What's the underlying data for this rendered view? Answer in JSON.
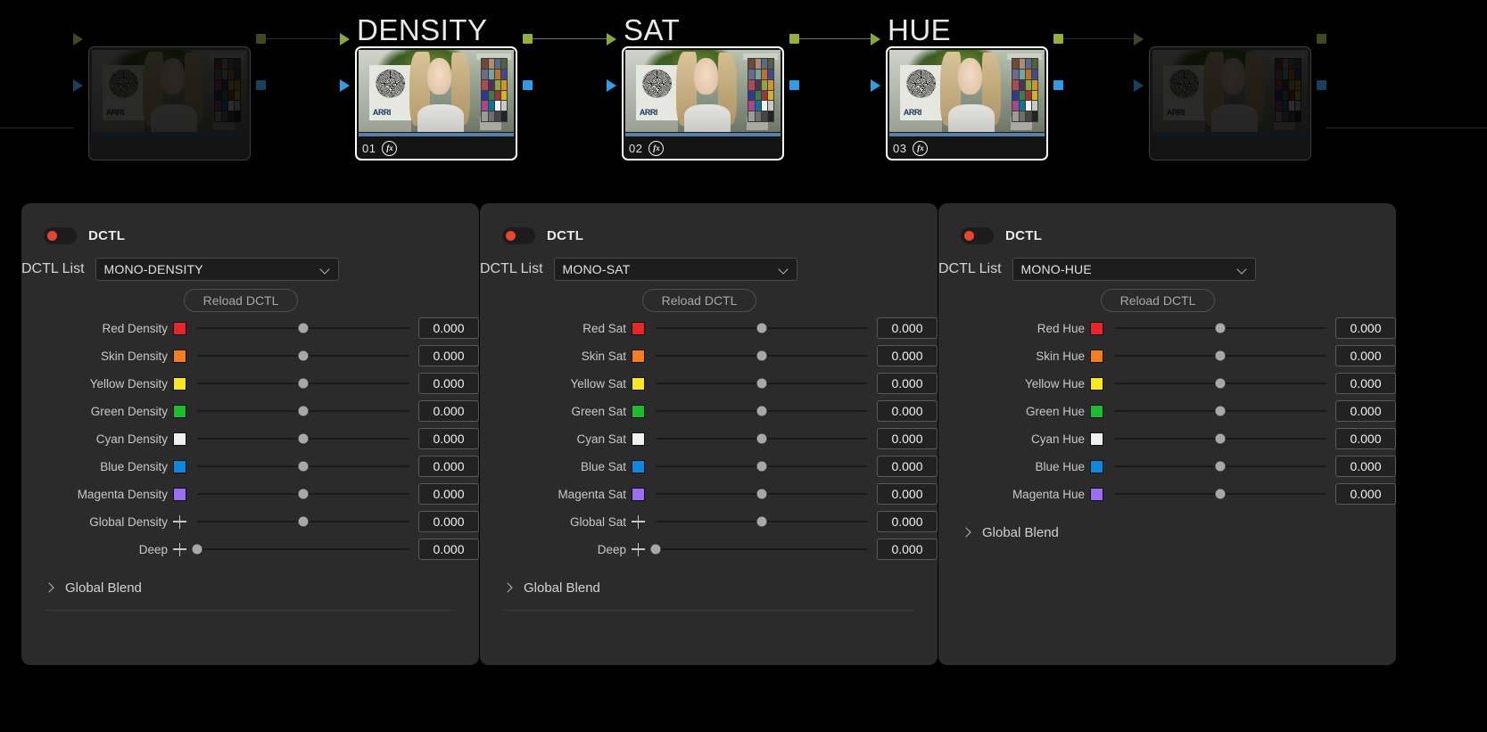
{
  "node_graph": {
    "nodes": [
      {
        "name": "node-source",
        "title": "",
        "number": "",
        "fx": false,
        "selected": false,
        "dim": true
      },
      {
        "name": "node-density",
        "title": "DENSITY",
        "number": "01",
        "fx": true,
        "selected": true,
        "dim": false
      },
      {
        "name": "node-sat",
        "title": "SAT",
        "number": "02",
        "fx": true,
        "selected": true,
        "dim": false
      },
      {
        "name": "node-hue",
        "title": "HUE",
        "number": "03",
        "fx": true,
        "selected": true,
        "dim": false
      },
      {
        "name": "node-output",
        "title": "",
        "number": "",
        "fx": false,
        "selected": false,
        "dim": true
      }
    ],
    "fx_glyph": "fx"
  },
  "swatch_colors": {
    "red": "#e8252b",
    "skin": "#f57c1f",
    "yellow": "#fae81e",
    "green": "#1dbe2e",
    "cyan": "#f0f0f0",
    "blue": "#0e87de",
    "magenta": "#9b6ef3"
  },
  "accent": {
    "toggle_on": "#e8442e",
    "node_selected_border": "#ffffff",
    "port_green": "#94b13a",
    "port_blue": "#2f9ce8",
    "thumb_bar": "#5a7fa8"
  },
  "panels": [
    {
      "name": "panel-density",
      "title": "DCTL",
      "dctl_list_label": "DCTL List",
      "dctl_list_value": "MONO-DENSITY",
      "reload_label": "Reload DCTL",
      "global_blend_label": "Global Blend",
      "show_divider": true,
      "rows": [
        {
          "label": "Red Density",
          "swatch": "red",
          "value": "0.000",
          "knob_pct": 50
        },
        {
          "label": "Skin Density",
          "swatch": "skin",
          "value": "0.000",
          "knob_pct": 50
        },
        {
          "label": "Yellow Density",
          "swatch": "yellow",
          "value": "0.000",
          "knob_pct": 50
        },
        {
          "label": "Green Density",
          "swatch": "green",
          "value": "0.000",
          "knob_pct": 50
        },
        {
          "label": "Cyan Density",
          "swatch": "cyan",
          "value": "0.000",
          "knob_pct": 50
        },
        {
          "label": "Blue Density",
          "swatch": "blue",
          "value": "0.000",
          "knob_pct": 50
        },
        {
          "label": "Magenta Density",
          "swatch": "magenta",
          "value": "0.000",
          "knob_pct": 50
        },
        {
          "label": "Global Density",
          "swatch": "plus",
          "value": "0.000",
          "knob_pct": 50
        },
        {
          "label": "Deep",
          "swatch": "plus",
          "value": "0.000",
          "knob_pct": 0
        }
      ]
    },
    {
      "name": "panel-sat",
      "title": "DCTL",
      "dctl_list_label": "DCTL List",
      "dctl_list_value": "MONO-SAT",
      "reload_label": "Reload DCTL",
      "global_blend_label": "Global Blend",
      "show_divider": true,
      "rows": [
        {
          "label": "Red Sat",
          "swatch": "red",
          "value": "0.000",
          "knob_pct": 50
        },
        {
          "label": "Skin Sat",
          "swatch": "skin",
          "value": "0.000",
          "knob_pct": 50
        },
        {
          "label": "Yellow Sat",
          "swatch": "yellow",
          "value": "0.000",
          "knob_pct": 50
        },
        {
          "label": "Green Sat",
          "swatch": "green",
          "value": "0.000",
          "knob_pct": 50
        },
        {
          "label": "Cyan Sat",
          "swatch": "cyan",
          "value": "0.000",
          "knob_pct": 50
        },
        {
          "label": "Blue Sat",
          "swatch": "blue",
          "value": "0.000",
          "knob_pct": 50
        },
        {
          "label": "Magenta Sat",
          "swatch": "magenta",
          "value": "0.000",
          "knob_pct": 50
        },
        {
          "label": "Global Sat",
          "swatch": "plus",
          "value": "0.000",
          "knob_pct": 50
        },
        {
          "label": "Deep",
          "swatch": "plus",
          "value": "0.000",
          "knob_pct": 0
        }
      ]
    },
    {
      "name": "panel-hue",
      "title": "DCTL",
      "dctl_list_label": "DCTL List",
      "dctl_list_value": "MONO-HUE",
      "reload_label": "Reload DCTL",
      "global_blend_label": "Global Blend",
      "show_divider": false,
      "rows": [
        {
          "label": "Red Hue",
          "swatch": "red",
          "value": "0.000",
          "knob_pct": 50
        },
        {
          "label": "Skin Hue",
          "swatch": "skin",
          "value": "0.000",
          "knob_pct": 50
        },
        {
          "label": "Yellow Hue",
          "swatch": "yellow",
          "value": "0.000",
          "knob_pct": 50
        },
        {
          "label": "Green Hue",
          "swatch": "green",
          "value": "0.000",
          "knob_pct": 50
        },
        {
          "label": "Cyan Hue",
          "swatch": "cyan",
          "value": "0.000",
          "knob_pct": 50
        },
        {
          "label": "Blue Hue",
          "swatch": "blue",
          "value": "0.000",
          "knob_pct": 50
        },
        {
          "label": "Magenta Hue",
          "swatch": "magenta",
          "value": "0.000",
          "knob_pct": 50
        }
      ]
    }
  ]
}
